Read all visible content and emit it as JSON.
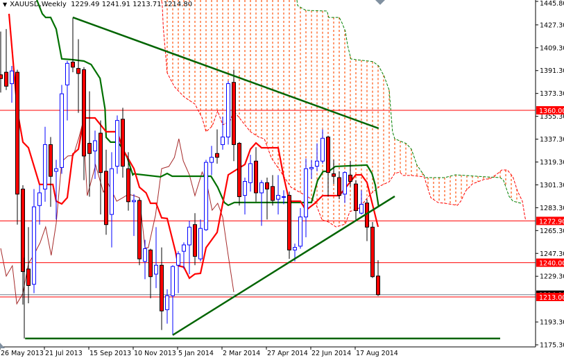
{
  "header": {
    "symbol": "XAUUSD,Weekly",
    "ohlc": "1229.49 1241.91 1213.71 1214.80"
  },
  "chart_data": {
    "type": "candlestick",
    "title": "XAUUSD,Weekly",
    "ylim": [
      1175.3,
      1445.8
    ],
    "y_ticks": [
      "1445.80",
      "1427.30",
      "1409.30",
      "1391.30",
      "1373.30",
      "1355.30",
      "1337.30",
      "1319.30",
      "1301.30",
      "1283.30",
      "1265.30",
      "1247.30",
      "1229.30",
      "1193.30",
      "1175.30"
    ],
    "x_ticks": [
      {
        "index": 0,
        "label": "26 May 2013"
      },
      {
        "index": 8,
        "label": "21 Jul 2013"
      },
      {
        "index": 16,
        "label": "15 Sep 2013"
      },
      {
        "index": 24,
        "label": "10 Nov 2013"
      },
      {
        "index": 32,
        "label": "5 Jan 2014"
      },
      {
        "index": 40,
        "label": "2 Mar 2014"
      },
      {
        "index": 48,
        "label": "27 Apr 2014"
      },
      {
        "index": 56,
        "label": "22 Jun 2014"
      },
      {
        "index": 64,
        "label": "17 Aug 2014"
      }
    ],
    "candles_ohlc": [
      [
        1388,
        1422,
        1374,
        1385
      ],
      [
        1390,
        1424,
        1376,
        1379
      ],
      [
        1381,
        1395,
        1366,
        1391
      ],
      [
        1390,
        1392,
        1270,
        1294
      ],
      [
        1298,
        1301,
        1207,
        1233
      ],
      [
        1235,
        1268,
        1208,
        1222
      ],
      [
        1223,
        1298,
        1216,
        1284
      ],
      [
        1285,
        1301,
        1270,
        1295
      ],
      [
        1298,
        1347,
        1288,
        1333
      ],
      [
        1333,
        1339,
        1284,
        1308
      ],
      [
        1312,
        1321,
        1274,
        1314
      ],
      [
        1315,
        1380,
        1310,
        1373
      ],
      [
        1380,
        1399,
        1352,
        1397
      ],
      [
        1398,
        1433,
        1390,
        1394
      ],
      [
        1393,
        1416,
        1358,
        1389
      ],
      [
        1392,
        1394,
        1305,
        1324
      ],
      [
        1334,
        1375,
        1292,
        1326
      ],
      [
        1328,
        1344,
        1306,
        1336
      ],
      [
        1342,
        1352,
        1278,
        1311
      ],
      [
        1312,
        1329,
        1262,
        1270
      ],
      [
        1278,
        1327,
        1252,
        1314
      ],
      [
        1316,
        1356,
        1310,
        1352
      ],
      [
        1353,
        1362,
        1307,
        1316
      ],
      [
        1314,
        1327,
        1281,
        1288
      ],
      [
        1288,
        1294,
        1261,
        1289
      ],
      [
        1289,
        1291,
        1238,
        1243
      ],
      [
        1241,
        1258,
        1227,
        1251
      ],
      [
        1250,
        1251,
        1212,
        1229
      ],
      [
        1231,
        1268,
        1220,
        1238
      ],
      [
        1238,
        1252,
        1187,
        1202
      ],
      [
        1203,
        1219,
        1192,
        1214
      ],
      [
        1214,
        1238,
        1183,
        1237
      ],
      [
        1238,
        1249,
        1216,
        1247
      ],
      [
        1249,
        1256,
        1235,
        1254
      ],
      [
        1254,
        1273,
        1231,
        1268
      ],
      [
        1270,
        1279,
        1238,
        1245
      ],
      [
        1243,
        1274,
        1241,
        1267
      ],
      [
        1266,
        1321,
        1265,
        1319
      ],
      [
        1319,
        1332,
        1309,
        1323
      ],
      [
        1326,
        1345,
        1318,
        1323
      ],
      [
        1333,
        1355,
        1329,
        1339
      ],
      [
        1339,
        1383,
        1333,
        1381
      ],
      [
        1382,
        1392,
        1320,
        1333
      ],
      [
        1334,
        1335,
        1285,
        1292
      ],
      [
        1293,
        1307,
        1278,
        1304
      ],
      [
        1303,
        1325,
        1296,
        1318
      ],
      [
        1320,
        1331,
        1288,
        1295
      ],
      [
        1295,
        1305,
        1269,
        1303
      ],
      [
        1303,
        1307,
        1274,
        1298
      ],
      [
        1300,
        1309,
        1285,
        1289
      ],
      [
        1290,
        1309,
        1278,
        1293
      ],
      [
        1292,
        1297,
        1286,
        1292
      ],
      [
        1293,
        1296,
        1243,
        1250
      ],
      [
        1250,
        1255,
        1241,
        1252
      ],
      [
        1253,
        1283,
        1251,
        1276
      ],
      [
        1276,
        1322,
        1260,
        1314
      ],
      [
        1314,
        1321,
        1306,
        1315
      ],
      [
        1316,
        1334,
        1312,
        1320
      ],
      [
        1320,
        1345,
        1318,
        1338
      ],
      [
        1339,
        1340,
        1292,
        1311
      ],
      [
        1310,
        1321,
        1302,
        1308
      ],
      [
        1307,
        1312,
        1290,
        1293
      ],
      [
        1294,
        1312,
        1287,
        1311
      ],
      [
        1309,
        1320,
        1300,
        1304
      ],
      [
        1302,
        1305,
        1274,
        1281
      ],
      [
        1279,
        1297,
        1278,
        1286
      ],
      [
        1287,
        1290,
        1257,
        1268
      ],
      [
        1268,
        1272,
        1228,
        1229
      ],
      [
        1229.49,
        1241.91,
        1213.71,
        1214.8
      ]
    ],
    "tenkan_sen": [
      [
        1.5,
        1436
      ],
      [
        3,
        1359.5
      ],
      [
        4,
        1335
      ],
      [
        5,
        1330.5
      ],
      [
        7,
        1301.6
      ],
      [
        9.4,
        1301.6
      ],
      [
        10,
        1288.4
      ],
      [
        11,
        1286.3
      ],
      [
        12,
        1291.2
      ],
      [
        13,
        1325.6
      ],
      [
        14,
        1329.4
      ],
      [
        15,
        1354
      ],
      [
        17,
        1354
      ],
      [
        19,
        1343.1
      ],
      [
        21,
        1343.1
      ],
      [
        22,
        1329.4
      ],
      [
        24,
        1314.1
      ],
      [
        25,
        1299.4
      ],
      [
        26.2,
        1295
      ],
      [
        27,
        1286.8
      ],
      [
        28,
        1286.8
      ],
      [
        29,
        1275.3
      ],
      [
        30,
        1274.8
      ],
      [
        31.5,
        1248.6
      ],
      [
        32,
        1237.6
      ],
      [
        33,
        1236.5
      ],
      [
        34,
        1227.8
      ],
      [
        35,
        1231.1
      ],
      [
        36,
        1231.6
      ],
      [
        37,
        1251.8
      ],
      [
        39,
        1263.9
      ],
      [
        41,
        1309.2
      ],
      [
        42,
        1311.9
      ],
      [
        44,
        1317.4
      ],
      [
        45,
        1329.4
      ],
      [
        46,
        1334.3
      ],
      [
        47,
        1330.5
      ],
      [
        50,
        1330.5
      ],
      [
        51,
        1307.6
      ],
      [
        52,
        1288.4
      ],
      [
        54,
        1288.4
      ],
      [
        55,
        1281.3
      ],
      [
        56.6,
        1286.8
      ],
      [
        58,
        1292.8
      ],
      [
        61,
        1292.8
      ],
      [
        64,
        1309.2
      ],
      [
        65,
        1309.2
      ],
      [
        66,
        1303.2
      ],
      [
        68,
        1268.2
      ]
    ],
    "kijun_sen": [
      [
        6.5,
        1447
      ],
      [
        7.5,
        1436
      ],
      [
        8.1,
        1433.2
      ],
      [
        9,
        1433.2
      ],
      [
        10,
        1424
      ],
      [
        11,
        1400.5
      ],
      [
        12.9,
        1399.9
      ],
      [
        15,
        1398.8
      ],
      [
        16.3,
        1396.1
      ],
      [
        17.9,
        1385.2
      ],
      [
        18.8,
        1361.1
      ],
      [
        19,
        1338.7
      ],
      [
        19.8,
        1334.9
      ],
      [
        21,
        1334.9
      ],
      [
        21.6,
        1332.2
      ],
      [
        22.8,
        1322.9
      ],
      [
        23.8,
        1309.2
      ],
      [
        24,
        1310
      ],
      [
        28.8,
        1307.6
      ],
      [
        30,
        1310.3
      ],
      [
        30.9,
        1308.1
      ],
      [
        37.9,
        1308.1
      ],
      [
        39.1,
        1299.4
      ],
      [
        40.3,
        1287.4
      ],
      [
        41,
        1285.2
      ],
      [
        42.1,
        1287.4
      ],
      [
        56,
        1287.4
      ],
      [
        57.1,
        1304.8
      ],
      [
        58.1,
        1311.9
      ],
      [
        59.1,
        1311.9
      ],
      [
        60.3,
        1315.8
      ],
      [
        66,
        1316.9
      ],
      [
        66.9,
        1310.3
      ],
      [
        67.5,
        1301.1
      ],
      [
        68.1,
        1284.1
      ]
    ],
    "chikou_span": [
      [
        0,
        1251.3
      ],
      [
        1,
        1229.4
      ],
      [
        2.1,
        1237.6
      ],
      [
        2.9,
        1207.6
      ],
      [
        4,
        1215.8
      ],
      [
        5,
        1239.3
      ],
      [
        6,
        1246.4
      ],
      [
        7.1,
        1255.7
      ],
      [
        8.1,
        1268.2
      ],
      [
        9.1,
        1245.8
      ],
      [
        10,
        1271
      ],
      [
        11,
        1319.6
      ],
      [
        12.1,
        1324
      ],
      [
        13.1,
        1324.5
      ],
      [
        14.1,
        1338.7
      ],
      [
        14.8,
        1350.2
      ],
      [
        15.6,
        1292.8
      ],
      [
        17.1,
        1316.9
      ],
      [
        18.5,
        1295.6
      ],
      [
        19.4,
        1302.1
      ],
      [
        20.9,
        1288.4
      ],
      [
        22,
        1291.2
      ],
      [
        23,
        1293.9
      ],
      [
        24,
        1292.8
      ],
      [
        25,
        1291.2
      ],
      [
        26,
        1251.8
      ],
      [
        26.6,
        1251.8
      ],
      [
        27.9,
        1277.5
      ],
      [
        29,
        1314.1
      ],
      [
        30.3,
        1315.8
      ],
      [
        31.3,
        1322.9
      ],
      [
        32.1,
        1337.6
      ],
      [
        32.9,
        1320.1
      ],
      [
        34,
        1309.2
      ],
      [
        35,
        1292.8
      ],
      [
        36.3,
        1311.4
      ],
      [
        37.1,
        1303.2
      ],
      [
        38.1,
        1281.3
      ],
      [
        39.1,
        1286.8
      ],
      [
        40,
        1275.9
      ],
      [
        40.9,
        1248.6
      ],
      [
        42,
        1216.9
      ]
    ],
    "senkou_span_b": [
      [
        29,
        1460
      ],
      [
        53,
        1460
      ],
      [
        53.5,
        1442.5
      ],
      [
        55,
        1438.7
      ],
      [
        58.8,
        1438.2
      ],
      [
        59.1,
        1433.2
      ],
      [
        61,
        1433.2
      ],
      [
        61.5,
        1428.9
      ],
      [
        62.1,
        1422.3
      ],
      [
        62.5,
        1411.4
      ],
      [
        63.1,
        1400.5
      ],
      [
        64,
        1399.9
      ],
      [
        66.3,
        1398.8
      ],
      [
        67.1,
        1398.3
      ],
      [
        68.1,
        1395
      ],
      [
        69.1,
        1386.8
      ],
      [
        70,
        1375.9
      ],
      [
        70.6,
        1343.1
      ],
      [
        71,
        1337.6
      ],
      [
        73.1,
        1333.8
      ],
      [
        74,
        1329.4
      ],
      [
        75,
        1316.9
      ],
      [
        76.3,
        1308.7
      ],
      [
        76.5,
        1307
      ],
      [
        80,
        1307
      ],
      [
        81.9,
        1309.2
      ],
      [
        87.5,
        1307.6
      ],
      [
        90,
        1307
      ],
      [
        90.6,
        1304.8
      ],
      [
        91.6,
        1292.3
      ],
      [
        92.3,
        1288.4
      ],
      [
        93.8,
        1286.8
      ]
    ],
    "senkou_span_a": [
      [
        29,
        1446
      ],
      [
        29.1,
        1444.2
      ],
      [
        29.3,
        1425
      ],
      [
        30,
        1389.5
      ],
      [
        31.3,
        1378.6
      ],
      [
        33.1,
        1370.4
      ],
      [
        35,
        1364.9
      ],
      [
        36.3,
        1354
      ],
      [
        37,
        1343.1
      ],
      [
        38.1,
        1347.5
      ],
      [
        39.1,
        1359.5
      ],
      [
        40,
        1348.6
      ],
      [
        41.3,
        1351.3
      ],
      [
        42,
        1359.5
      ],
      [
        45,
        1343.1
      ],
      [
        46.6,
        1338.7
      ],
      [
        47.5,
        1337.6
      ],
      [
        48.8,
        1322.3
      ],
      [
        50.4,
        1312
      ],
      [
        52.3,
        1299.4
      ],
      [
        53.4,
        1296.6
      ],
      [
        55,
        1292.8
      ],
      [
        56.6,
        1288.4
      ],
      [
        57.9,
        1273.7
      ],
      [
        59.1,
        1272
      ],
      [
        60.4,
        1268.2
      ],
      [
        62.1,
        1270.4
      ],
      [
        62.9,
        1280.2
      ],
      [
        64.6,
        1283
      ],
      [
        66.6,
        1293.9
      ],
      [
        68.4,
        1300.5
      ],
      [
        70,
        1303.7
      ],
      [
        71,
        1310.3
      ],
      [
        71.9,
        1311.4
      ],
      [
        72.5,
        1308.7
      ],
      [
        74,
        1308.7
      ],
      [
        76.3,
        1307.6
      ],
      [
        76.9,
        1299.4
      ],
      [
        77.5,
        1291.2
      ],
      [
        78.8,
        1287.4
      ],
      [
        80,
        1286.8
      ],
      [
        82.3,
        1285.2
      ],
      [
        82.9,
        1288.4
      ],
      [
        83.8,
        1296.6
      ],
      [
        85,
        1302.1
      ],
      [
        86,
        1303.7
      ],
      [
        87.3,
        1305.9
      ],
      [
        88.1,
        1305.9
      ],
      [
        89.4,
        1309.7
      ],
      [
        90.3,
        1313
      ],
      [
        91.3,
        1313
      ],
      [
        92.3,
        1307.6
      ],
      [
        93.1,
        1296.6
      ],
      [
        94,
        1288.4
      ],
      [
        94.4,
        1277.5
      ],
      [
        94.6,
        1273.2
      ]
    ],
    "horizontal_levels": [
      {
        "price": 1360.0,
        "label": "1360.00"
      },
      {
        "price": 1272.9,
        "label": "1272.90"
      },
      {
        "price": 1240.0,
        "label": "1240.00"
      },
      {
        "price": 1213.0,
        "label": "1213.00"
      }
    ],
    "bid_line": {
      "price": 1214.8,
      "label": "1214.80"
    },
    "trendlines": [
      {
        "name": "descending-resistance",
        "from": [
          13,
          1433.2
        ],
        "to": [
          68.1,
          1345.8
        ]
      },
      {
        "name": "ascending-support",
        "from": [
          31,
          1183
        ],
        "to": [
          71,
          1292.3
        ]
      },
      {
        "name": "horizontal-support",
        "from": [
          4.4,
          1180.3
        ],
        "to": [
          90,
          1180.3
        ]
      }
    ],
    "colors": {
      "bull": "#0000ff",
      "bear": "#ff0000",
      "tenkan": "#ff0000",
      "kijun": "#007000",
      "chikou": "#a52a2a",
      "cloud": "#ff6020",
      "span_b": "#008000",
      "level": "#ff0000",
      "trend": "#006400",
      "bid": "#708090"
    }
  }
}
